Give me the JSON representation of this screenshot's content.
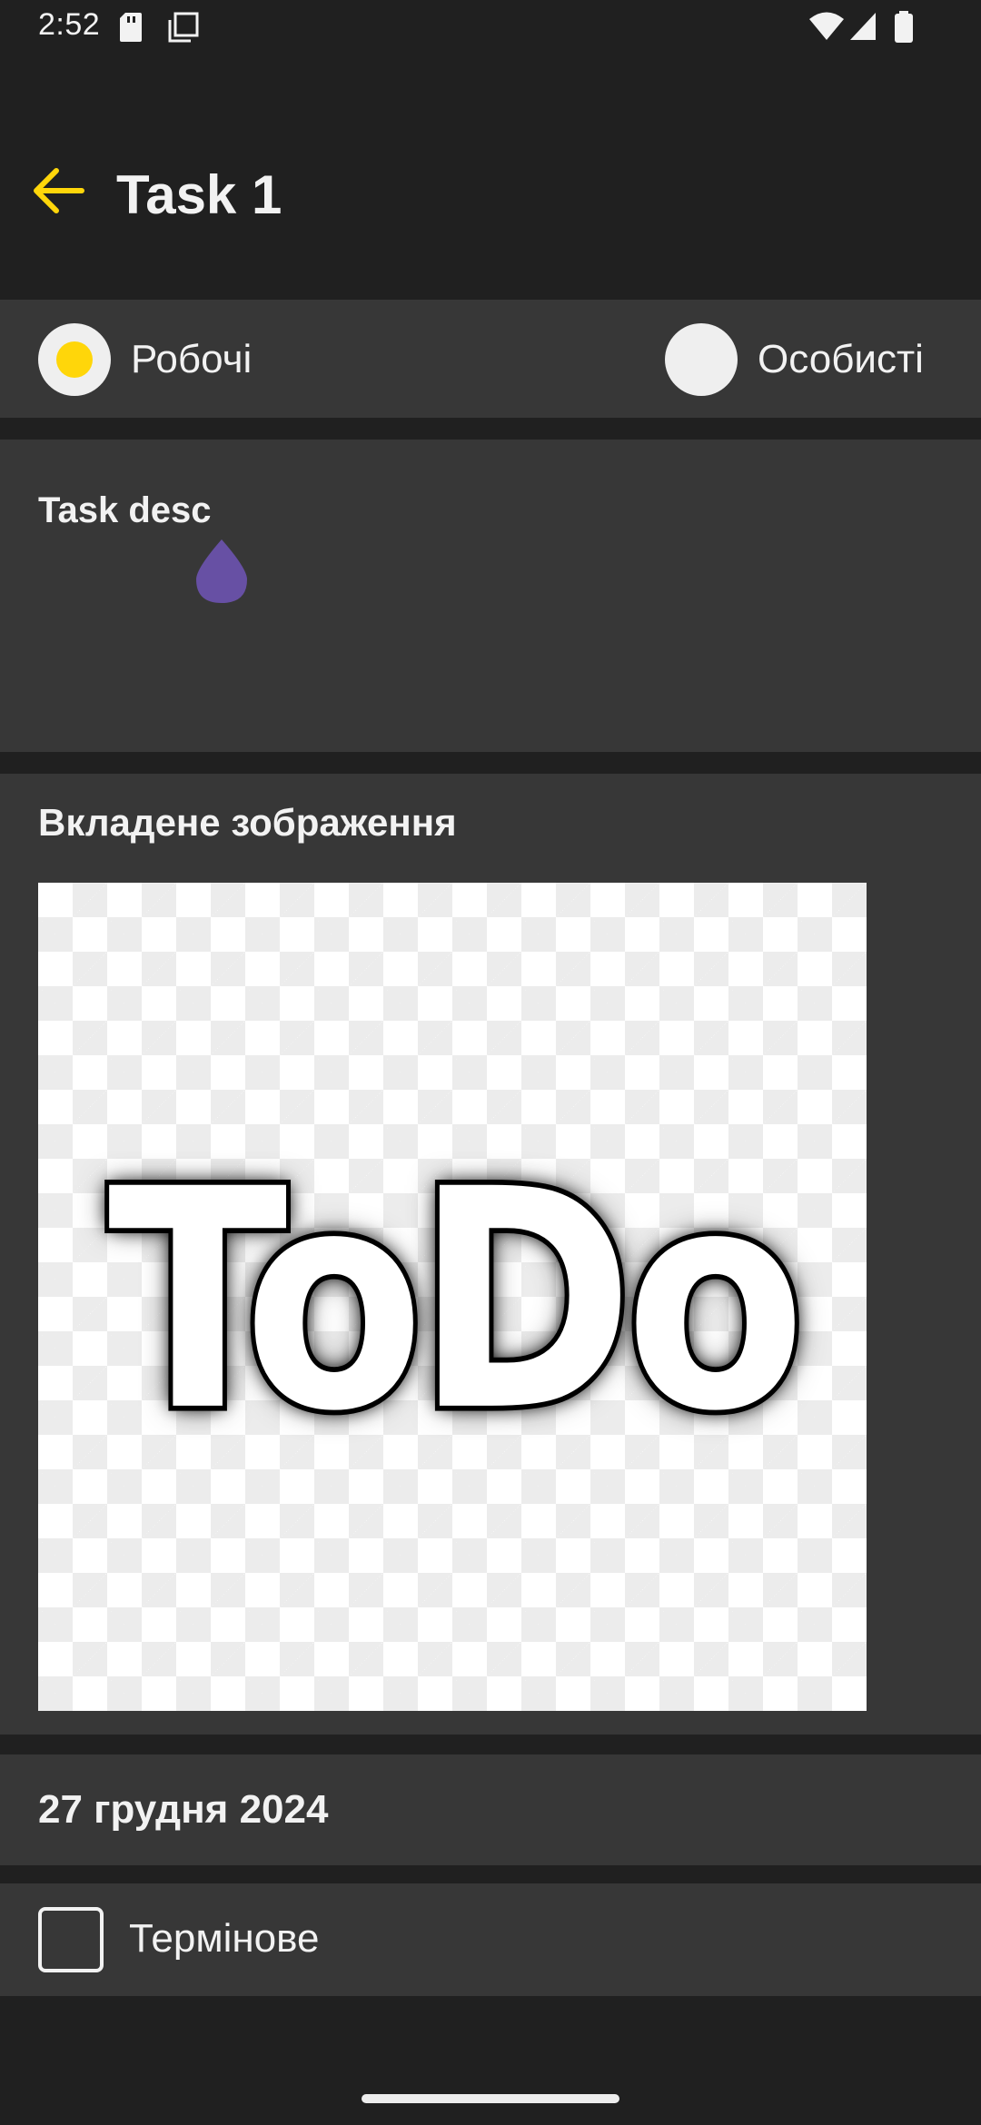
{
  "status_bar": {
    "time": "2:52",
    "icons": [
      "sd-card-icon",
      "screenshot-icon",
      "wifi-icon",
      "signal-icon",
      "battery-icon"
    ]
  },
  "header": {
    "back_icon": "arrow-left-icon",
    "title": "Task 1"
  },
  "category": {
    "options": [
      {
        "label": "Робочі",
        "selected": true
      },
      {
        "label": "Особисті",
        "selected": false
      }
    ]
  },
  "description": {
    "text": "Task desc"
  },
  "attachment": {
    "heading": "Вкладене зображення",
    "image_text": "ToDo"
  },
  "date": {
    "text": "27 грудня 2024"
  },
  "urgent": {
    "label": "Термінове",
    "checked": false
  },
  "colors": {
    "accent": "#ffd60a",
    "background": "#202020",
    "card": "#373737",
    "text_handle": "#6750a4"
  }
}
